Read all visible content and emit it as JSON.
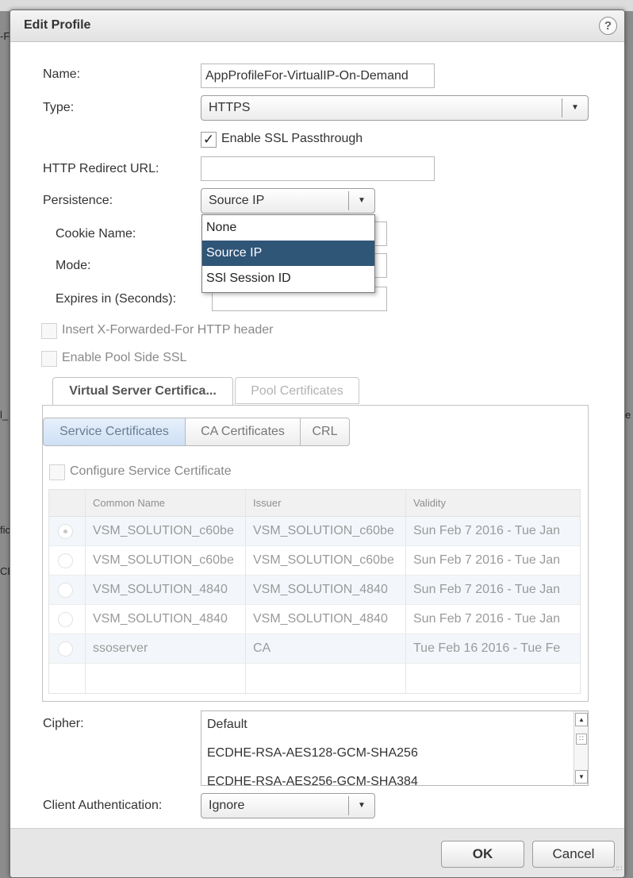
{
  "background": {
    "fragments": [
      "-F",
      "l_",
      "e",
      "fic",
      "CR"
    ]
  },
  "dialog": {
    "title": "Edit Profile",
    "help_icon": "?"
  },
  "form": {
    "name": {
      "label": "Name:",
      "value": "AppProfileFor-VirtualIP-On-Demand"
    },
    "type": {
      "label": "Type:",
      "value": "HTTPS"
    },
    "ssl_passthrough": {
      "label": "Enable SSL Passthrough",
      "checked": true
    },
    "redirect_url": {
      "label": "HTTP Redirect URL:",
      "value": ""
    },
    "persistence": {
      "label": "Persistence:",
      "value": "Source IP",
      "options": [
        "None",
        "Source IP",
        "SSl Session ID"
      ],
      "highlighted": "Source IP"
    },
    "cookie_name": {
      "label": "Cookie Name:"
    },
    "mode": {
      "label": "Mode:"
    },
    "expires": {
      "label": "Expires in (Seconds):"
    },
    "insert_xff": {
      "label": "Insert X-Forwarded-For HTTP header",
      "checked": false
    },
    "pool_side_ssl": {
      "label": "Enable Pool Side SSL",
      "checked": false
    },
    "cipher": {
      "label": "Cipher:",
      "items": [
        "Default",
        "ECDHE-RSA-AES128-GCM-SHA256",
        "ECDHE-RSA-AES256-GCM-SHA384"
      ]
    },
    "client_auth": {
      "label": "Client Authentication:",
      "value": "Ignore"
    }
  },
  "tabs": {
    "outer": [
      "Virtual Server Certifica...",
      "Pool Certificates"
    ],
    "inner": [
      "Service Certificates",
      "CA Certificates",
      "CRL"
    ]
  },
  "certificates": {
    "configure_label": "Configure Service Certificate",
    "columns": [
      "Common Name",
      "Issuer",
      "Validity"
    ],
    "rows": [
      {
        "common_name": "VSM_SOLUTION_c60be",
        "issuer": "VSM_SOLUTION_c60be",
        "validity": "Sun Feb 7 2016 - Tue Jan",
        "selected": true
      },
      {
        "common_name": "VSM_SOLUTION_c60be",
        "issuer": "VSM_SOLUTION_c60be",
        "validity": "Sun Feb 7 2016 - Tue Jan",
        "selected": false
      },
      {
        "common_name": "VSM_SOLUTION_4840",
        "issuer": "VSM_SOLUTION_4840",
        "validity": "Sun Feb 7 2016 - Tue Jan",
        "selected": false
      },
      {
        "common_name": "VSM_SOLUTION_4840",
        "issuer": "VSM_SOLUTION_4840",
        "validity": "Sun Feb 7 2016 - Tue Jan",
        "selected": false
      },
      {
        "common_name": "ssoserver",
        "issuer": "CA",
        "validity": "Tue Feb 16 2016 - Tue Fe",
        "selected": false
      }
    ]
  },
  "buttons": {
    "ok": "OK",
    "cancel": "Cancel"
  }
}
